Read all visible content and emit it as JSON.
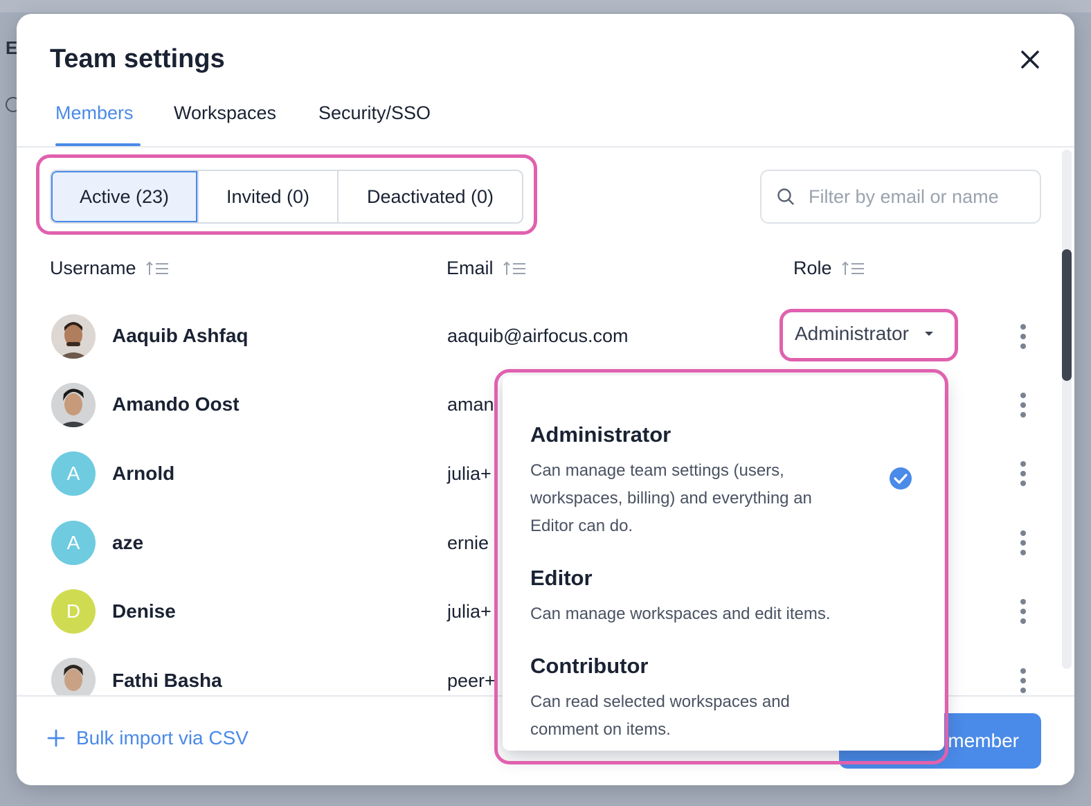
{
  "modal": {
    "title": "Team settings",
    "tabs": [
      {
        "label": "Members",
        "active": true
      },
      {
        "label": "Workspaces",
        "active": false
      },
      {
        "label": "Security/SSO",
        "active": false
      }
    ]
  },
  "status_filter": {
    "options": [
      {
        "label": "Active (23)",
        "active": true
      },
      {
        "label": "Invited (0)",
        "active": false
      },
      {
        "label": "Deactivated (0)",
        "active": false
      }
    ]
  },
  "search": {
    "placeholder": "Filter by email or name",
    "value": ""
  },
  "table": {
    "headers": {
      "username": "Username",
      "email": "Email",
      "role": "Role"
    },
    "rows": [
      {
        "name": "Aaquib Ashfaq",
        "email": "aaquib@airfocus.com",
        "role": "Administrator",
        "avatar": "photo"
      },
      {
        "name": "Amando Oost",
        "email": "aman",
        "avatar": "photo"
      },
      {
        "name": "Arnold",
        "email": "julia+",
        "avatar": "A",
        "avatar_color": "#6ecbe0"
      },
      {
        "name": "aze",
        "email": "ernie",
        "avatar": "A",
        "avatar_color": "#6ecbe0"
      },
      {
        "name": "Denise",
        "email": "julia+",
        "avatar": "D",
        "avatar_color": "#cfdc52"
      },
      {
        "name": "Fathi Basha",
        "email": "peer+",
        "avatar": "photo"
      }
    ]
  },
  "role_dropdown": {
    "options": [
      {
        "title": "Administrator",
        "description": "Can manage team settings (users, workspaces, billing) and everything an Editor can do.",
        "selected": true
      },
      {
        "title": "Editor",
        "description": "Can manage workspaces and edit items.",
        "selected": false
      },
      {
        "title": "Contributor",
        "description": "Can read selected workspaces and comment on items.",
        "selected": false
      }
    ]
  },
  "footer": {
    "bulk_import": "Bulk import via CSV",
    "add_member_visible_text": "member"
  },
  "colors": {
    "accent": "#4a8ae8",
    "highlight": "#e061ae",
    "text": "#1a2233"
  }
}
